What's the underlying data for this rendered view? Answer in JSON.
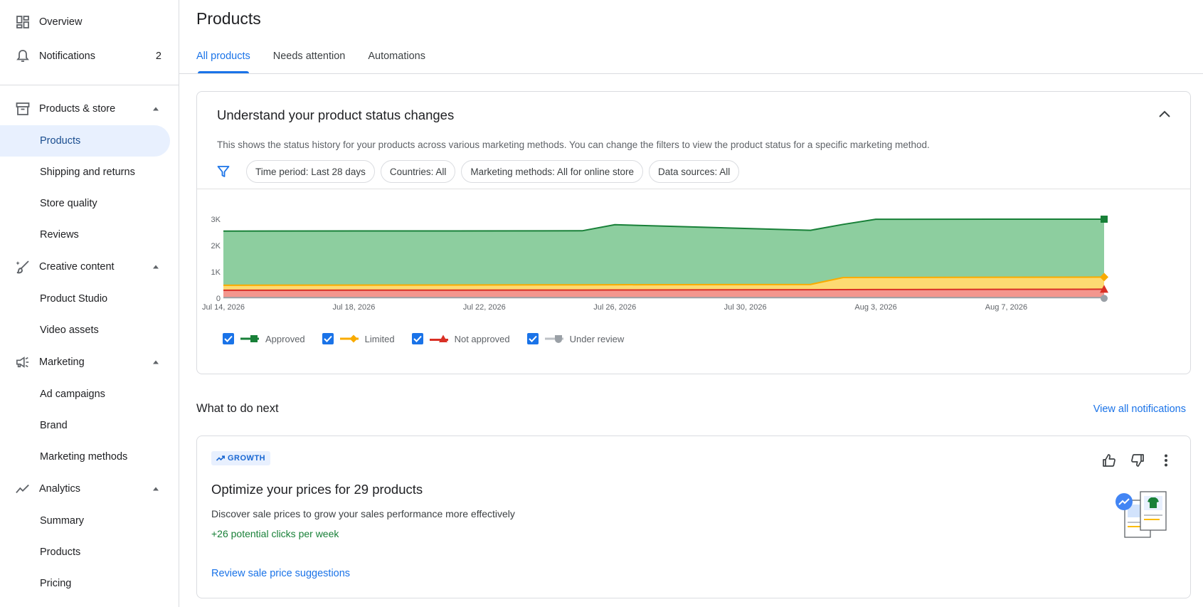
{
  "sidebar": {
    "overview": "Overview",
    "notifications": {
      "label": "Notifications",
      "count": "2"
    },
    "groups": [
      {
        "label": "Products & store",
        "items": [
          "Products",
          "Shipping and returns",
          "Store quality",
          "Reviews"
        ]
      },
      {
        "label": "Creative content",
        "items": [
          "Product Studio",
          "Video assets"
        ]
      },
      {
        "label": "Marketing",
        "items": [
          "Ad campaigns",
          "Brand",
          "Marketing methods"
        ]
      },
      {
        "label": "Analytics",
        "items": [
          "Summary",
          "Products",
          "Pricing"
        ]
      }
    ],
    "active_item": "Products"
  },
  "page": {
    "title": "Products",
    "tabs": [
      "All products",
      "Needs attention",
      "Automations"
    ],
    "active_tab": "All products"
  },
  "status_card": {
    "title": "Understand your product status changes",
    "description": "This shows the status history for your products across various marketing methods. You can change the filters to view the product status for a specific marketing method.",
    "filters": [
      "Time period: Last 28 days",
      "Countries: All",
      "Marketing methods: All for online store",
      "Data sources: All"
    ],
    "legend": [
      "Approved",
      "Limited",
      "Not approved",
      "Under review"
    ]
  },
  "chart_data": {
    "type": "area",
    "stacked": true,
    "x_ticks": [
      "Jul 14, 2026",
      "Jul 18, 2026",
      "Jul 22, 2026",
      "Jul 26, 2026",
      "Jul 30, 2026",
      "Aug 3, 2026",
      "Aug 7, 2026"
    ],
    "y_ticks": [
      "0",
      "1K",
      "2K",
      "3K"
    ],
    "ylim": [
      0,
      3000
    ],
    "x_start": "2026-07-14",
    "x_end": "2026-08-10",
    "series": [
      {
        "name": "Under review",
        "color": "#9aa0a6",
        "x": [
          "2026-07-14",
          "2026-08-10"
        ],
        "y": [
          20,
          20
        ]
      },
      {
        "name": "Not approved",
        "color": "#d93025",
        "x": [
          "2026-07-14",
          "2026-07-26",
          "2026-08-10"
        ],
        "y": [
          280,
          290,
          320
        ]
      },
      {
        "name": "Limited",
        "color": "#f9ab00",
        "x": [
          "2026-07-14",
          "2026-07-26",
          "2026-08-01",
          "2026-08-02",
          "2026-08-10"
        ],
        "y": [
          190,
          200,
          200,
          460,
          460
        ]
      },
      {
        "name": "Approved",
        "color": "#188038",
        "x": [
          "2026-07-14",
          "2026-07-25",
          "2026-07-26",
          "2026-08-02",
          "2026-08-03",
          "2026-08-10"
        ],
        "y": [
          2060,
          2050,
          2280,
          2020,
          2210,
          2200
        ]
      }
    ]
  },
  "next": {
    "title": "What to do next",
    "view_all": "View all notifications"
  },
  "growth_card": {
    "badge": "GROWTH",
    "title": "Optimize your prices for 29 products",
    "description": "Discover sale prices to grow your sales performance more effectively",
    "clicks": "+26 potential clicks per week",
    "link": "Review sale price suggestions"
  },
  "colors": {
    "accent": "#1a73e8",
    "approved": "#188038",
    "limited": "#f9ab00",
    "not_approved": "#d93025",
    "under_review": "#9aa0a6"
  }
}
